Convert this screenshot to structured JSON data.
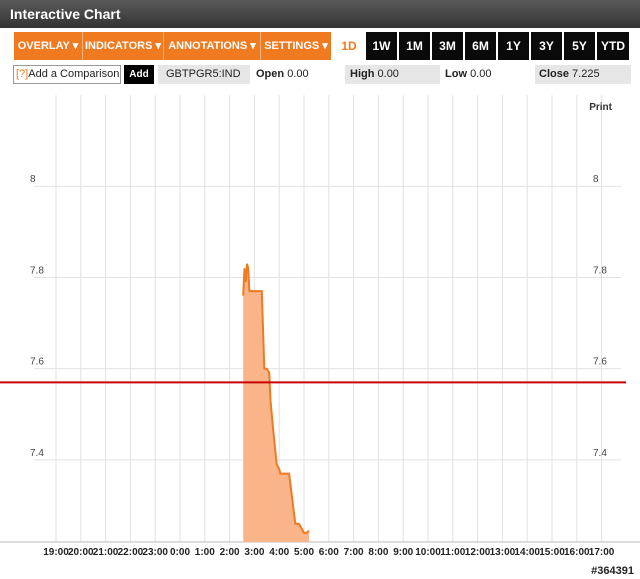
{
  "window": {
    "title": "Interactive Chart"
  },
  "toolbar": {
    "menus": [
      {
        "label": "OVERLAY ▾"
      },
      {
        "label": "INDICATORS ▾"
      },
      {
        "label": "ANNOTATIONS ▾"
      },
      {
        "label": "SETTINGS ▾"
      }
    ],
    "ranges": [
      "1D",
      "1W",
      "1M",
      "3M",
      "6M",
      "1Y",
      "3Y",
      "5Y",
      "YTD"
    ],
    "active_range": "1D",
    "accent_color": "#f07a20"
  },
  "comparison": {
    "help": "[?]",
    "placeholder": "Add a Comparison",
    "add_label": "Add"
  },
  "quote": {
    "ticker": "GBTPGR5:IND",
    "open_label": "Open",
    "open_value": "0.00",
    "high_label": "High",
    "high_value": "0.00",
    "low_label": "Low",
    "low_value": "0.00",
    "close_label": "Close",
    "close_value": "7.225"
  },
  "chart": {
    "print_label": "Print"
  },
  "chart_data": {
    "type": "area",
    "title": "",
    "xlabel": "",
    "ylabel": "",
    "x_ticks": [
      "19:00",
      "20:00",
      "21:00",
      "22:00",
      "23:00",
      "0:00",
      "1:00",
      "2:00",
      "3:00",
      "4:00",
      "5:00",
      "6:00",
      "7:00",
      "8:00",
      "9:00",
      "10:00",
      "11:00",
      "12:00",
      "13:00",
      "14:00",
      "15:00",
      "16:00",
      "17:00"
    ],
    "y_ticks": [
      "7.4",
      "7.6",
      "7.8",
      "8"
    ],
    "ylim": [
      7.22,
      8.2
    ],
    "series": [
      {
        "values_x": [
          2.55,
          2.6,
          2.65,
          2.7,
          2.75,
          2.8,
          2.9,
          3.0,
          3.3,
          3.4,
          3.5,
          3.6,
          3.65,
          3.75,
          3.9,
          4.0,
          4.05,
          4.1,
          4.2,
          4.4,
          4.65,
          4.8,
          5.0,
          5.1,
          5.2
        ],
        "values_y": [
          7.76,
          7.82,
          7.79,
          7.83,
          7.82,
          7.77,
          7.77,
          7.77,
          7.77,
          7.6,
          7.6,
          7.59,
          7.53,
          7.47,
          7.39,
          7.38,
          7.37,
          7.37,
          7.37,
          7.37,
          7.26,
          7.26,
          7.24,
          7.24,
          7.245
        ],
        "color": "#f07a20",
        "fill": "#f9b48a"
      }
    ],
    "reference_line": {
      "y": 7.57,
      "color": "#c80000"
    },
    "grid": true
  },
  "footer": {
    "watermark": "#364391"
  }
}
